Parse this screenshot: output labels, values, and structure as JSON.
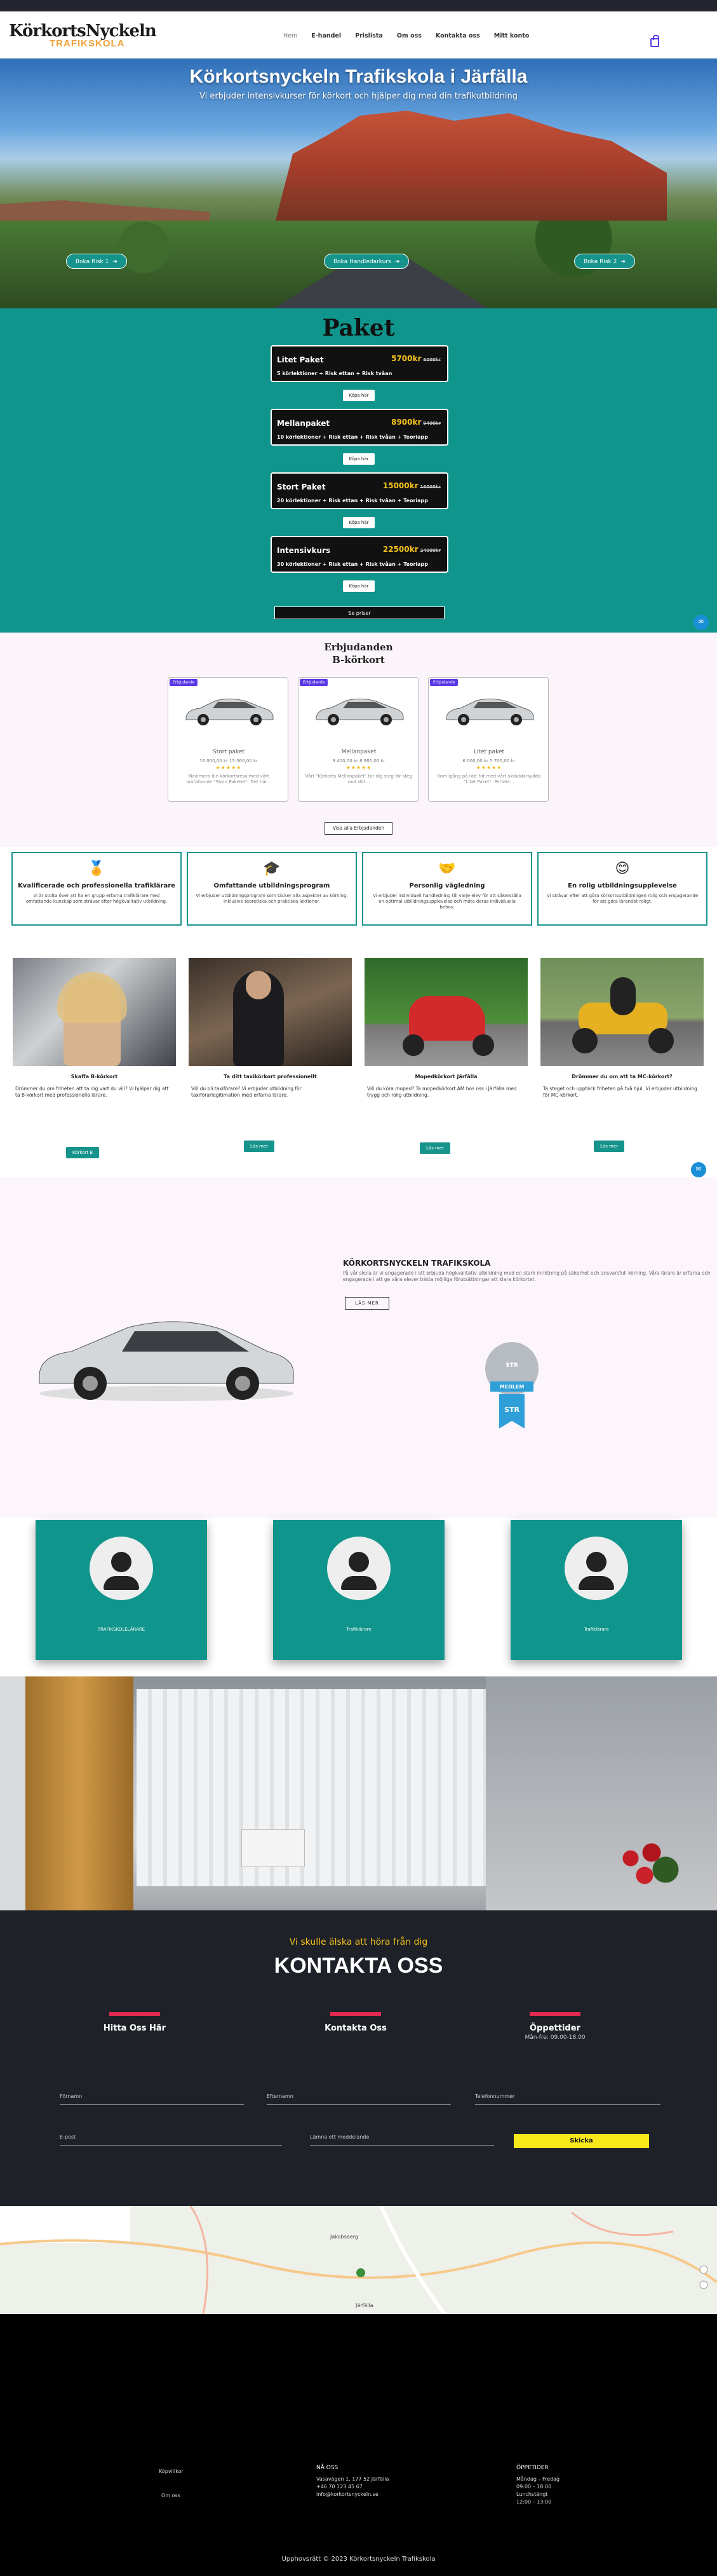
{
  "header": {
    "logo_top": "KörkortsNyckeln",
    "logo_bottom": "TRAFIKSKOLA",
    "nav": [
      "Hem",
      "E-handel",
      "Prislista",
      "Om oss",
      "Kontakta oss",
      "Mitt konto"
    ],
    "accent": "#5b37e6"
  },
  "hero": {
    "title": "Körkortsnyckeln Trafikskola i Järfälla",
    "subtitle": "Vi erbjuder intensivkurser för körkort och hjälper dig med din trafikutbildning",
    "buttons": [
      "Boka Risk 1",
      "Boka Handledarkurs",
      "Boka Risk 2"
    ]
  },
  "paket": {
    "title": "Paket",
    "cards": [
      {
        "name": "Litet Paket",
        "price": "5700kr",
        "old": "6000kr",
        "desc": "5 körlektioner + Risk ettan + Risk tvåan"
      },
      {
        "name": "Mellanpaket",
        "price": "8900kr",
        "old": "9400kr",
        "desc": "10 körlektioner + Risk ettan + Risk tvåan + Teoriapp"
      },
      {
        "name": "Stort Paket",
        "price": "15000kr",
        "old": "16000kr",
        "desc": "20 körlektioner + Risk ettan + Risk tvåan + Teoriapp"
      },
      {
        "name": "Intensivkurs",
        "price": "22500kr",
        "old": "24000kr",
        "desc": "30 körlektioner + Risk ettan + Risk tvåan + Teoriapp"
      }
    ],
    "card_button": "Köpa här",
    "all_button": "Se priser",
    "colors": {
      "price": "#f4c21b",
      "bg": "#10958d"
    }
  },
  "offers": {
    "title": "Erbjudanden",
    "subtitle": "B-körkort",
    "badge": "Erbjudande",
    "cards": [
      {
        "name": "Stort paket",
        "price": "16 000,00 kr 15 000,00 kr",
        "stars": "★★★★★",
        "desc": "Maximera din körkortsresa med vårt omfattande \"Stora Paketet\". Det här..."
      },
      {
        "name": "Mellanpaket",
        "price": "9 400,00 kr 8 900,00 kr",
        "stars": "★★★★★",
        "desc": "Vårt \"Körkorts Mellanpaket\" tar dig steg för steg mot ditt..."
      },
      {
        "name": "Litet paket",
        "price": "6 000,00 kr 5 700,00 kr",
        "stars": "★★★★★",
        "desc": "Kom igång på rätt fot med vårt skräddarsydda \"Litet Paket\". Perfekt..."
      }
    ],
    "view_button": "Visa alla Erbjudanden"
  },
  "features": [
    {
      "icon": "medal-icon",
      "glyph": "🏅",
      "title": "Kvalificerade och professionella trafiklärare",
      "desc": "Vi är stolta över att ha en grupp erfarna trafiklärare med omfattande kunskap som strävar efter högkvalitativ utbildning."
    },
    {
      "icon": "graduation-cap-icon",
      "glyph": "🎓",
      "title": "Omfattande utbildningsprogram",
      "desc": "Vi erbjuder utbildningsprogram som täcker alla aspekter av körning, inklusive teoretiska och praktiska lektioner."
    },
    {
      "icon": "handshake-icon",
      "glyph": "🤝",
      "title": "Personlig vägledning",
      "desc": "Vi erbjuder individuell handledning till varje elev för att säkerställa en optimal utbildningsupplevelse och möta deras individuella behov."
    },
    {
      "icon": "smile-icon",
      "glyph": "😊",
      "title": "En rolig utbildningsupplevelse",
      "desc": "Vi strävar efter att göra körkortsutbildningen rolig och engagerande för att göra lärandet roligt."
    }
  ],
  "services": [
    {
      "title": "Skaffa B-körkort",
      "desc": "Drömmer du om friheten att ta dig vart du vill? Vi hjälper dig att ta B-körkort med professionella lärare.",
      "button": "Körkort B"
    },
    {
      "title": "Ta ditt taxikörkort professionellt",
      "desc": "Vill du bli taxiförare? Vi erbjuder utbildning för taxiförarlegitimation med erfarna lärare.",
      "button": "Läs mer"
    },
    {
      "title": "Mopedkörkort Järfälla",
      "desc": "Vill du köra moped? Ta mopedkörkort AM hos oss i Järfälla med trygg och rolig utbildning.",
      "button": "Läs mer"
    },
    {
      "title": "Drömmer du om att ta MC-körkort?",
      "desc": "Ta steget och upptäck friheten på två hjul. Vi erbjuder utbildning för MC-körkort.",
      "button": "Läs mer"
    }
  ],
  "about": {
    "title": "KÖRKORTSNYCKELN TRAFIKSKOLA",
    "desc": "På vår skola är vi engagerade i att erbjuda högkvalitativ utbildning med en stark inriktning på säkerhet och ansvarsfull körning. Våra lärare är erfarna och engagerade i att ge våra elever bästa möjliga förutsättningar att klara körkortet.",
    "button": "LÄS MER",
    "badge_top": "STR",
    "badge_label": "MEDLEM"
  },
  "team": [
    "TRAFIKSKOLELÄRARE",
    "Trafiklärare",
    "Trafiklärare"
  ],
  "contact": {
    "intro": "Vi skulle älska att höra från dig",
    "title": "KONTAKTA OSS",
    "cols": [
      {
        "title": "Hitta Oss Här",
        "value": ""
      },
      {
        "title": "Kontakta Oss",
        "value": ""
      },
      {
        "title": "Öppettider",
        "value": "Mån-fre: 09.00-18.00"
      }
    ],
    "fields": {
      "first": "Förnamn",
      "last": "Efternamn",
      "phone": "Telefonnummer",
      "email": "E-post",
      "message": "Lämna ett meddelande"
    },
    "send": "Skicka",
    "accent": "#e02a52"
  },
  "map": {
    "places": [
      "Jakobsberg",
      "Järfälla"
    ]
  },
  "footer": {
    "links": [
      "Köpvillkor",
      "Om oss"
    ],
    "contact_title": "NÅ OSS",
    "contact_lines": [
      "Vasavägen 1, 177 52 Järfälla",
      "+46 70 123 45 67",
      "info@korkortsnyckeln.se"
    ],
    "hours_title": "ÖPPETIDER",
    "hours_lines": [
      "Måndag – Fredag",
      "09:00 – 18:00",
      "Lunchstängt",
      "12:00 – 13:00"
    ],
    "copyright": "Upphovsrätt © 2023 Körkortsnyckeln Trafikskola"
  }
}
